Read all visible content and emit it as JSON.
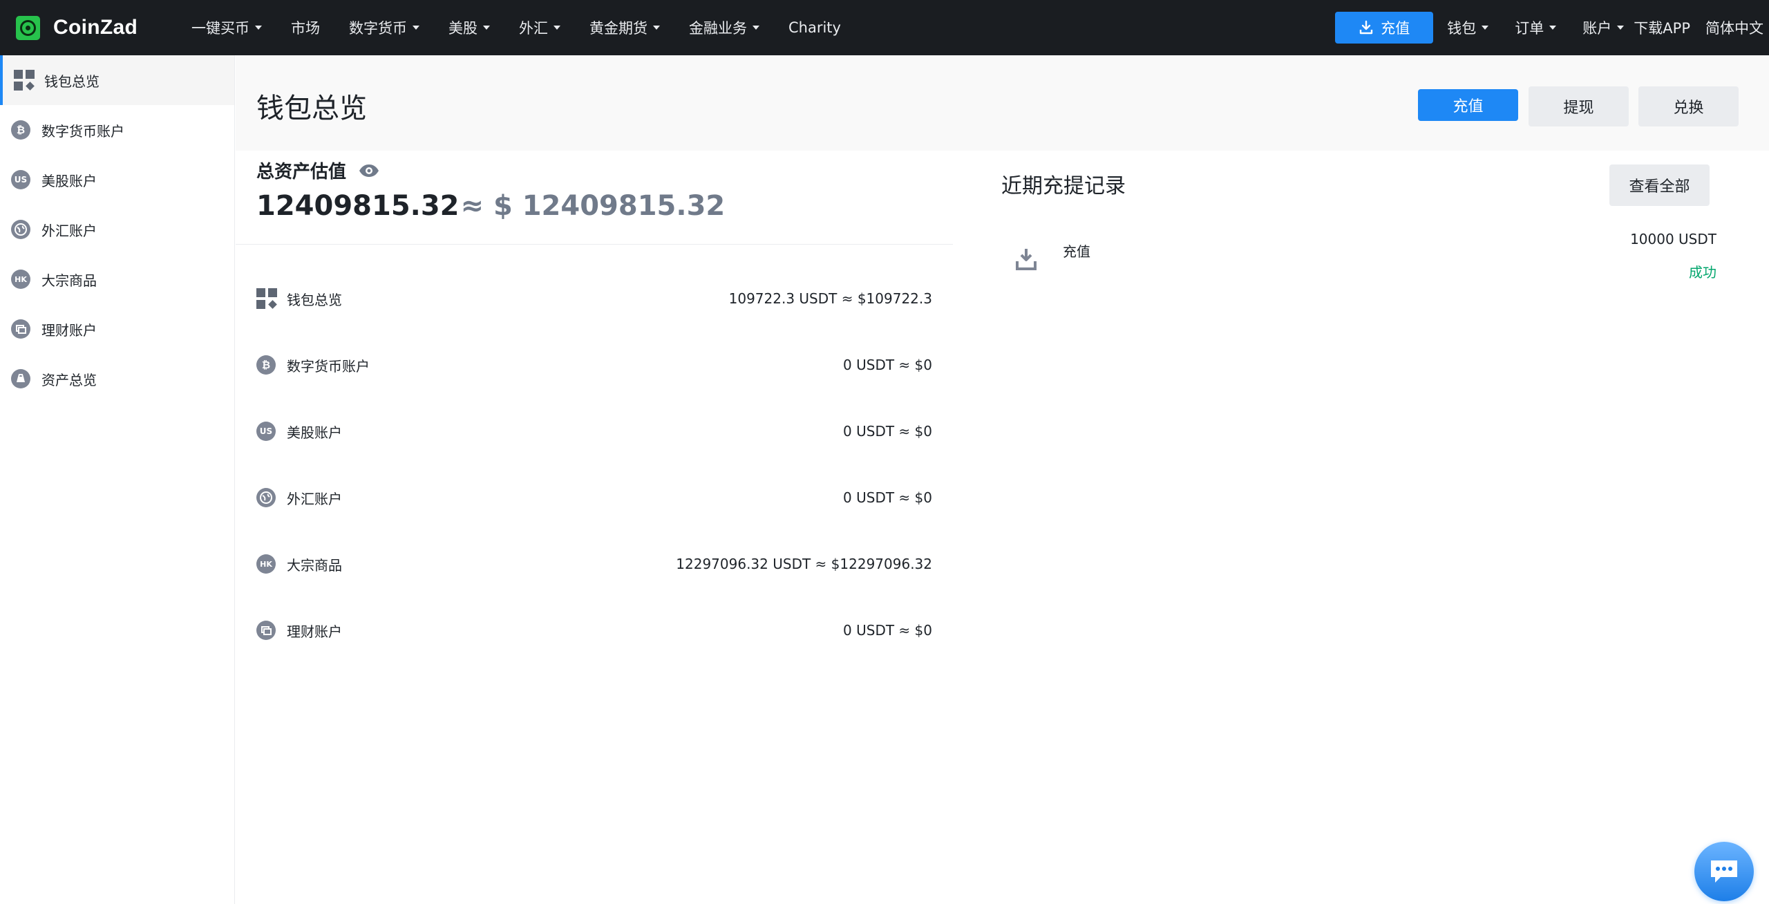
{
  "brand": {
    "name": "CoinZad"
  },
  "topnav": {
    "items": [
      {
        "label": "一键买币",
        "dropdown": true
      },
      {
        "label": "市场",
        "dropdown": false
      },
      {
        "label": "数字货币",
        "dropdown": true
      },
      {
        "label": "美股",
        "dropdown": true
      },
      {
        "label": "外汇",
        "dropdown": true
      },
      {
        "label": "黄金期货",
        "dropdown": true
      },
      {
        "label": "金融业务",
        "dropdown": true
      },
      {
        "label": "Charity",
        "dropdown": false
      }
    ],
    "deposit_label": "充值",
    "wallet_label": "钱包",
    "orders_label": "订单",
    "account_label": "账户",
    "download_label": "下载APP",
    "language_label": "简体中文"
  },
  "sidebar": {
    "items": [
      {
        "label": "钱包总览",
        "icon": "grid-icon",
        "active": true
      },
      {
        "label": "数字货币账户",
        "icon": "bitcoin-icon"
      },
      {
        "label": "美股账户",
        "icon": "us-icon"
      },
      {
        "label": "外汇账户",
        "icon": "globe-icon"
      },
      {
        "label": "大宗商品",
        "icon": "hk-icon"
      },
      {
        "label": "理财账户",
        "icon": "finance-icon"
      },
      {
        "label": "资产总览",
        "icon": "assets-icon"
      }
    ]
  },
  "header": {
    "title": "钱包总览",
    "deposit_label": "充值",
    "withdraw_label": "提现",
    "exchange_label": "兑换"
  },
  "assets": {
    "total_label": "总资产估值",
    "total_value": "12409815.32",
    "approx_value": "≈ $ 12409815.32",
    "accounts": [
      {
        "name": "钱包总览",
        "icon": "grid-icon",
        "value": "109722.3 USDT ≈ $109722.3"
      },
      {
        "name": "数字货币账户",
        "icon": "bitcoin-icon",
        "value": "0 USDT ≈ $0"
      },
      {
        "name": "美股账户",
        "icon": "us-icon",
        "value": "0 USDT ≈ $0"
      },
      {
        "name": "外汇账户",
        "icon": "globe-icon",
        "value": "0 USDT ≈ $0"
      },
      {
        "name": "大宗商品",
        "icon": "hk-icon",
        "value": "12297096.32 USDT ≈ $12297096.32"
      },
      {
        "name": "理财账户",
        "icon": "finance-icon",
        "value": "0 USDT ≈ $0"
      }
    ]
  },
  "records": {
    "title": "近期充提记录",
    "view_all_label": "查看全部",
    "items": [
      {
        "type": "充值",
        "amount": "10000 USDT",
        "status": "成功",
        "icon": "download-icon"
      }
    ]
  },
  "colors": {
    "accent": "#1e88f5",
    "topnav_bg": "#1a1d21",
    "success": "#03a66d",
    "brand": "#27c24c"
  }
}
